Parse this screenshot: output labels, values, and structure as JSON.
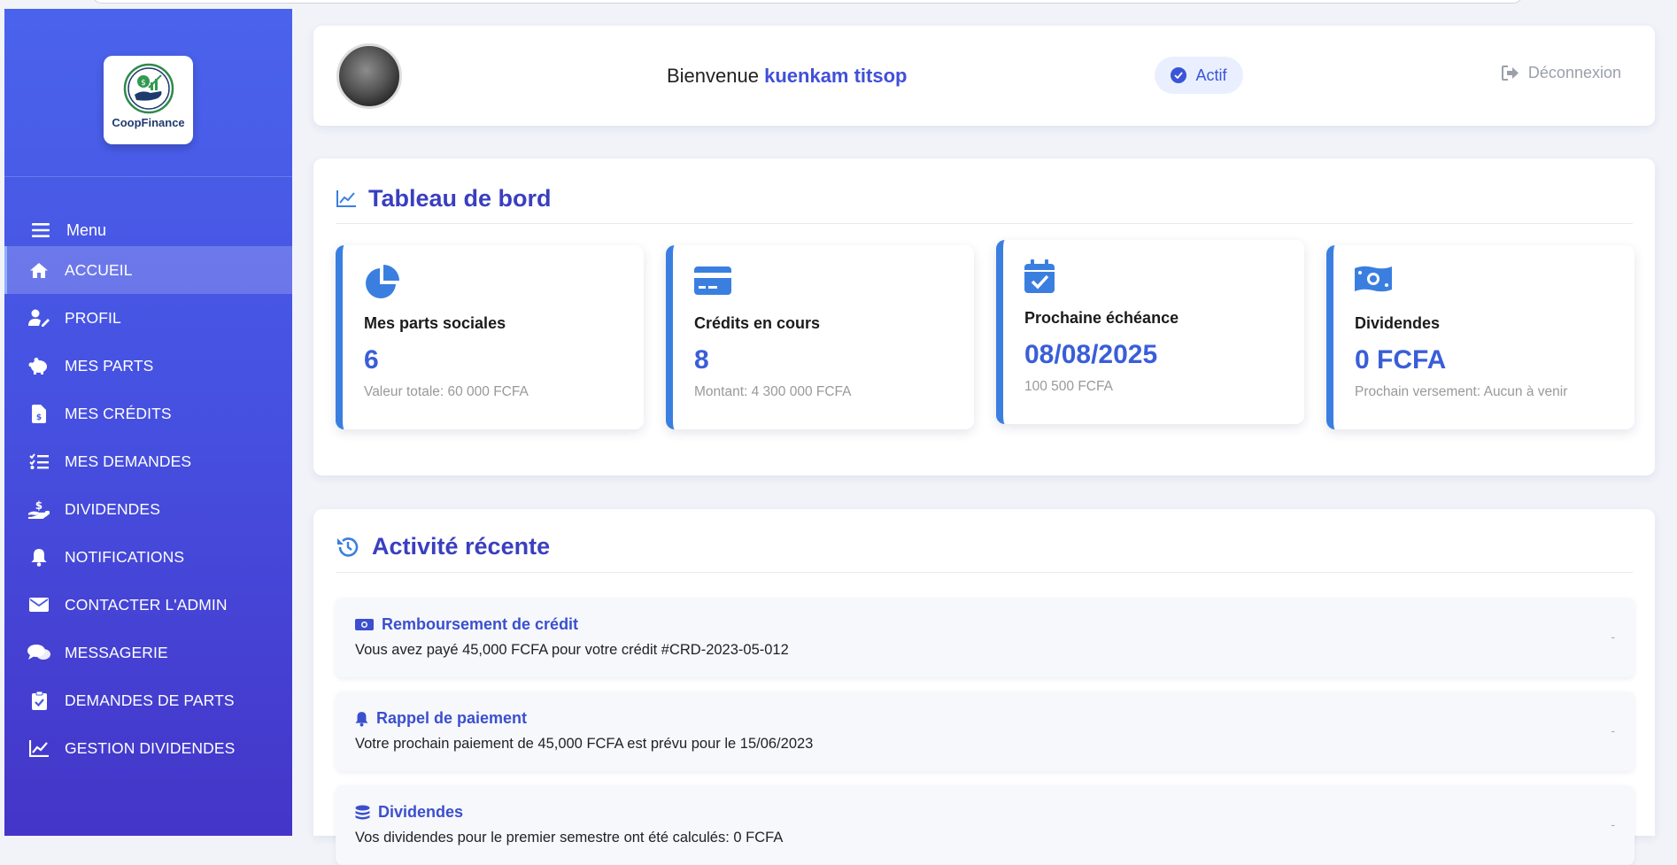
{
  "app": {
    "logo_text": "CoopFinance"
  },
  "sidebar": {
    "menu_label": "Menu",
    "items": [
      {
        "label": "ACCUEIL",
        "icon": "home-icon",
        "active": true
      },
      {
        "label": "PROFIL",
        "icon": "user-edit-icon"
      },
      {
        "label": "MES PARTS",
        "icon": "piggy-bank-icon"
      },
      {
        "label": "MES CRÉDITS",
        "icon": "invoice-dollar-icon"
      },
      {
        "label": "MES DEMANDES",
        "icon": "tasks-list-icon"
      },
      {
        "label": "DIVIDENDES",
        "icon": "hand-holding-usd-icon"
      },
      {
        "label": "NOTIFICATIONS",
        "icon": "bell-icon"
      },
      {
        "label": "CONTACTER L'ADMIN",
        "icon": "envelope-icon"
      },
      {
        "label": "MESSAGERIE",
        "icon": "comments-icon"
      },
      {
        "label": "DEMANDES DE PARTS",
        "icon": "clipboard-check-icon"
      },
      {
        "label": "GESTION DIVIDENDES",
        "icon": "chart-line-icon"
      }
    ]
  },
  "header": {
    "welcome_prefix": "Bienvenue",
    "user_name": "kuenkam titsop",
    "status": "Actif",
    "logout": "Déconnexion"
  },
  "dashboard": {
    "title": "Tableau de bord",
    "stats": [
      {
        "label": "Mes parts sociales",
        "value": "6",
        "sub": "Valeur totale: 60 000 FCFA",
        "icon": "pie-chart-icon"
      },
      {
        "label": "Crédits en cours",
        "value": "8",
        "sub": "Montant: 4 300 000 FCFA",
        "icon": "credit-card-icon"
      },
      {
        "label": "Prochaine échéance",
        "value": "08/08/2025",
        "sub": "100 500 FCFA",
        "icon": "calendar-check-icon"
      },
      {
        "label": "Dividendes",
        "value": "0 FCFA",
        "sub": "Prochain versement: Aucun à venir",
        "icon": "money-bill-icon"
      }
    ]
  },
  "activity": {
    "title": "Activité récente",
    "items": [
      {
        "title": "Remboursement de crédit",
        "desc": "Vous avez payé 45,000 FCFA pour votre crédit #CRD-2023-05-012",
        "time": "-",
        "icon": "money-bill-icon"
      },
      {
        "title": "Rappel de paiement",
        "desc": "Votre prochain paiement de 45,000 FCFA est prévu pour le 15/06/2023",
        "time": "-",
        "icon": "bell-icon"
      },
      {
        "title": "Dividendes",
        "desc": "Vos dividendes pour le premier semestre ont été calculés: 0 FCFA",
        "time": "-",
        "icon": "coins-icon"
      }
    ]
  },
  "colors": {
    "sidebar_top": "#4a63ec",
    "sidebar_bottom": "#4435c8",
    "accent": "#3a5ed8",
    "title": "#3a3fbf"
  }
}
